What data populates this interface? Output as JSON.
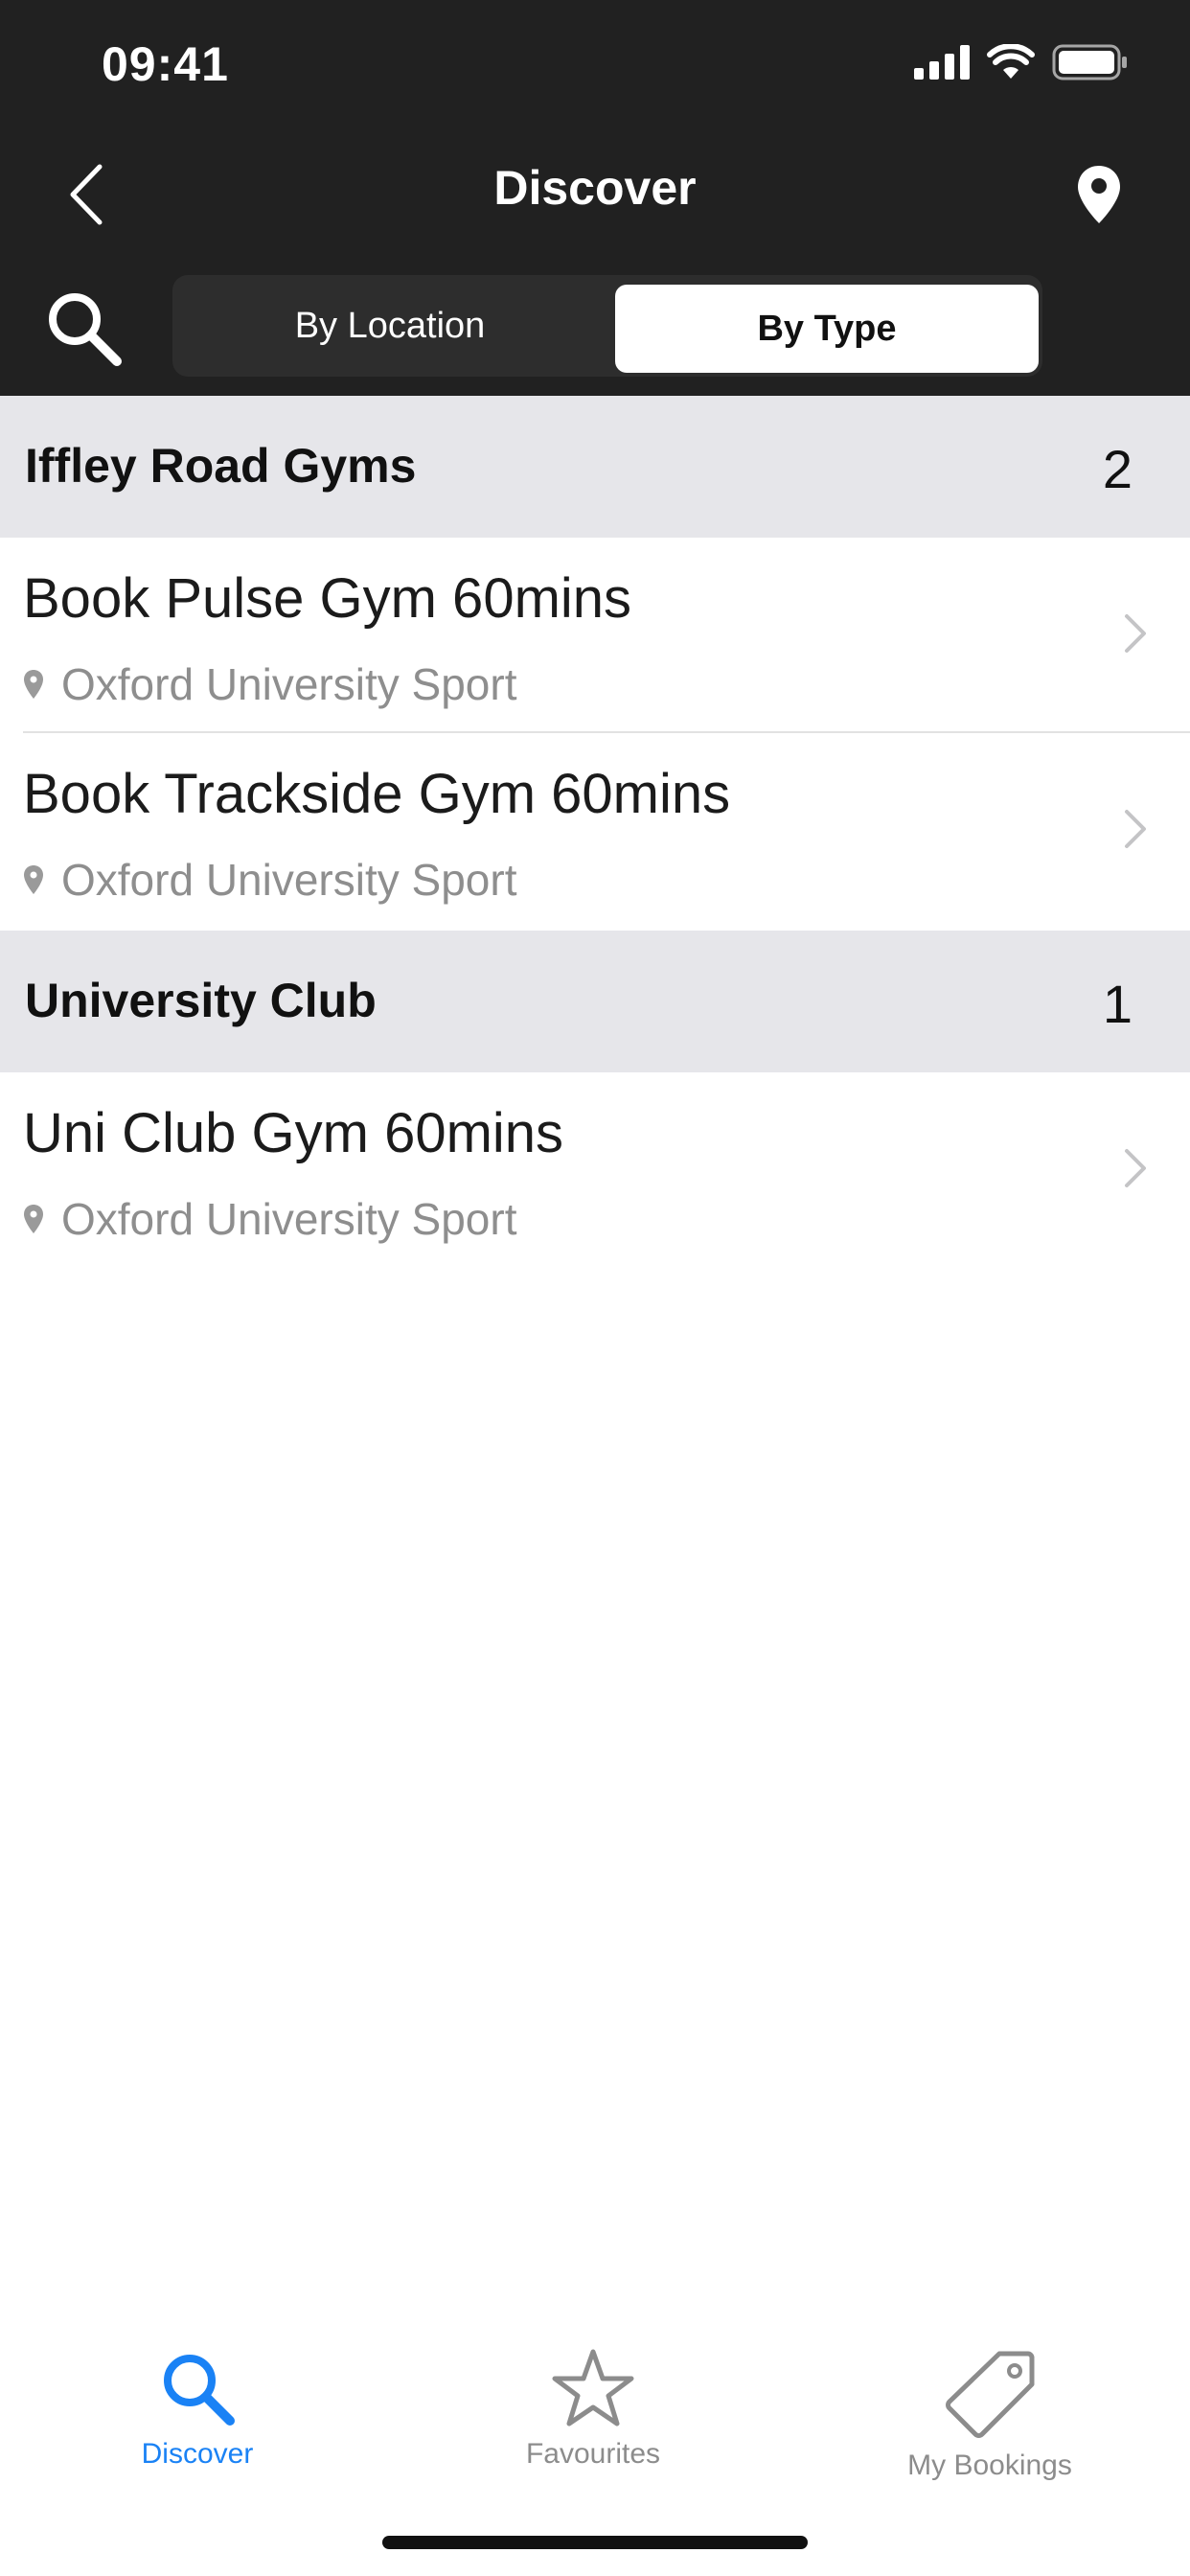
{
  "status_bar": {
    "time": "09:41"
  },
  "nav": {
    "title": "Discover",
    "back_icon": "chevron-left-icon",
    "location_icon": "map-pin-icon"
  },
  "filter": {
    "search_icon": "search-icon",
    "segments": [
      {
        "label": "By Location",
        "selected": false
      },
      {
        "label": "By Type",
        "selected": true
      }
    ]
  },
  "sections": [
    {
      "title": "Iffley Road Gyms",
      "count": "2",
      "items": [
        {
          "title": "Book Pulse Gym 60mins",
          "location": "Oxford University Sport"
        },
        {
          "title": "Book Trackside Gym 60mins",
          "location": "Oxford University Sport"
        }
      ]
    },
    {
      "title": "University Club",
      "count": "1",
      "items": [
        {
          "title": "Uni Club Gym 60mins",
          "location": "Oxford University Sport"
        }
      ]
    }
  ],
  "tab_bar": {
    "tabs": [
      {
        "label": "Discover",
        "icon": "search-icon",
        "active": true
      },
      {
        "label": "Favourites",
        "icon": "star-icon",
        "active": false
      },
      {
        "label": "My Bookings",
        "icon": "tag-icon",
        "active": false
      }
    ]
  },
  "colors": {
    "header_bg": "#212121",
    "section_bg": "#e6e6ea",
    "active_tab": "#1a82f5",
    "inactive_tab": "#8c8c8c"
  }
}
